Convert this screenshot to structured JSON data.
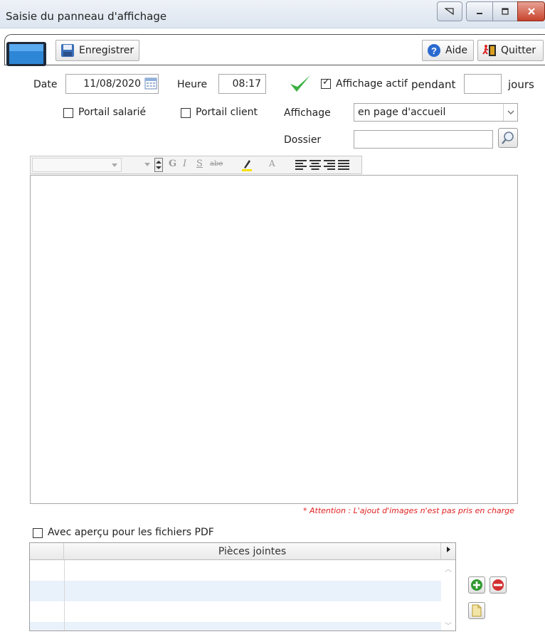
{
  "window": {
    "title": "Saisie du panneau d'affichage"
  },
  "toolbar": {
    "save_label": "Enregistrer",
    "help_label": "Aide",
    "quit_label": "Quitter"
  },
  "form": {
    "date_label": "Date",
    "date_value": "11/08/2020",
    "time_label": "Heure",
    "time_value": "08:17",
    "active_label": "Affichage actif",
    "active_checked": true,
    "pendant_label": "pendant",
    "days_value": "",
    "days_label": "jours",
    "portail_salarie_label": "Portail salarié",
    "portail_client_label": "Portail client",
    "affichage_label": "Affichage",
    "affichage_value": "en page d'accueil",
    "dossier_label": "Dossier",
    "dossier_value": ""
  },
  "editor": {
    "bold_glyph": "G",
    "italic_glyph": "I",
    "underline_glyph": "S",
    "strike_glyph": "abe",
    "color_glyph": "A",
    "content": ""
  },
  "warning_text": "* Attention : L'ajout d'images n'est pas pris en charge",
  "pdf_preview_label": "Avec aperçu pour les fichiers PDF",
  "attachments": {
    "header": "Pièces jointes"
  },
  "colors": {
    "warning": "#e02020",
    "row_alt": "#e9f1fb",
    "check_green": "#3cb043"
  }
}
